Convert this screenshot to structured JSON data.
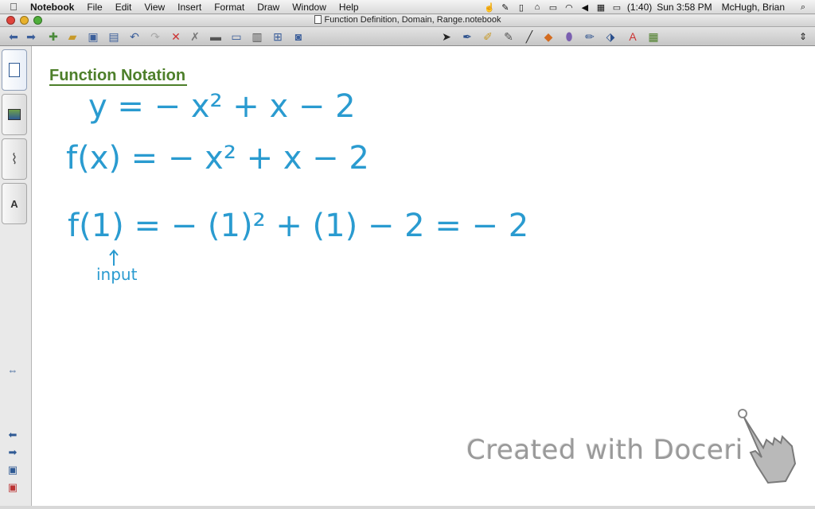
{
  "menubar": {
    "apple_icon": "apple-icon",
    "app_name": "Notebook",
    "menus": [
      "File",
      "Edit",
      "View",
      "Insert",
      "Format",
      "Draw",
      "Window",
      "Help"
    ],
    "battery": "(1:40)",
    "clock": "Sun 3:58 PM",
    "user": "McHugh, Brian"
  },
  "window": {
    "title": "Function Definition, Domain, Range.notebook"
  },
  "page": {
    "title": "Function Notation",
    "title_color": "#4d7f2a",
    "ink_color": "#2a9bd0",
    "equations": [
      "y = − x² + x − 2",
      "f(x) = − x² + x − 2",
      "f(1) = − (1)² + (1) − 2 = − 2"
    ],
    "annotation": "input"
  },
  "watermark": {
    "text": "Created with Doceri"
  },
  "colors": {
    "accent": "#2f5a94",
    "ink": "#2a9bd0",
    "title_green": "#4d7f2a",
    "close": "#e0443c",
    "minimize": "#e8b12c",
    "zoom": "#4fae3a"
  }
}
